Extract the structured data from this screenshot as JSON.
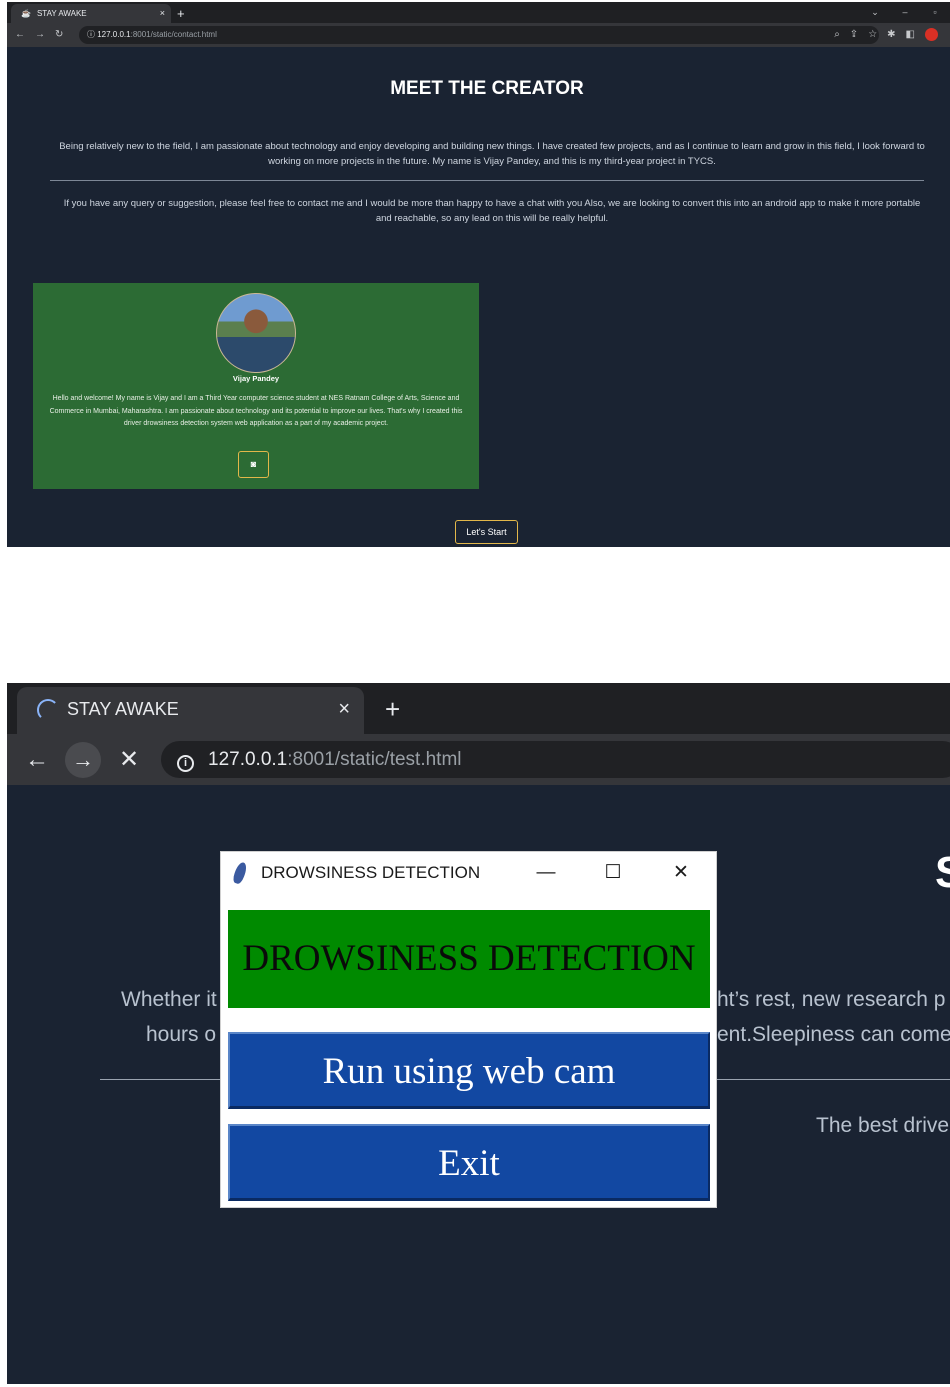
{
  "screenshot1": {
    "tab_title": "STAY AWAKE",
    "tab_close": "×",
    "new_tab": "+",
    "url_host": "127.0.0.1",
    "url_path": ":8001/static/contact.html",
    "heading": "MEET THE CREATOR",
    "paragraph1": "Being relatively new to the field, I am passionate about technology and enjoy developing and building new things. I have created few projects, and as I continue to learn and grow in this field, I look forward to working on more projects in the future. My name is Vijay Pandey, and this is my third-year project in TYCS.",
    "paragraph2": "If you have any query or suggestion, please feel free to contact me and I would be more than happy to have a chat with you Also, we are looking to convert this into an android app to make it more portable and reachable, so any lead on this will be really helpful.",
    "card": {
      "name": "Vijay Pandey",
      "bio": "Hello and welcome! My name is Vijay and I am a Third Year computer science student at NES Ratnam College of Arts, Science and Commerce in Mumbai, Maharashtra. I am passionate about technology and its potential to improve our lives. That's why I created this driver drowsiness detection system web application as a part of my academic project.",
      "icon": "instagram-icon"
    },
    "start_button": "Let's Start"
  },
  "screenshot2": {
    "tab_title": "STAY AWAKE",
    "tab_close": "×",
    "new_tab": "+",
    "url_host": "127.0.0.1",
    "url_path": ":8001/static/test.html",
    "bg_heading_fragment": "S",
    "bg_text_left1": "Whether it",
    "bg_text_left2": "hours o",
    "bg_text_right1": "ht’s rest, new research p",
    "bg_text_right2": "ent.Sleepiness can come",
    "bg_text_right3": "The best drive",
    "dialog": {
      "title": "DROWSINESS DETECTION",
      "banner": "DROWSINESS DETECTION",
      "run_button": "Run using web cam",
      "exit_button": "Exit"
    }
  },
  "colors": {
    "page_bg": "#1a2332",
    "card_green": "#2c6b34",
    "banner_green": "#008a00",
    "button_blue": "#1248a2",
    "accent_gold": "#e2b74a"
  }
}
